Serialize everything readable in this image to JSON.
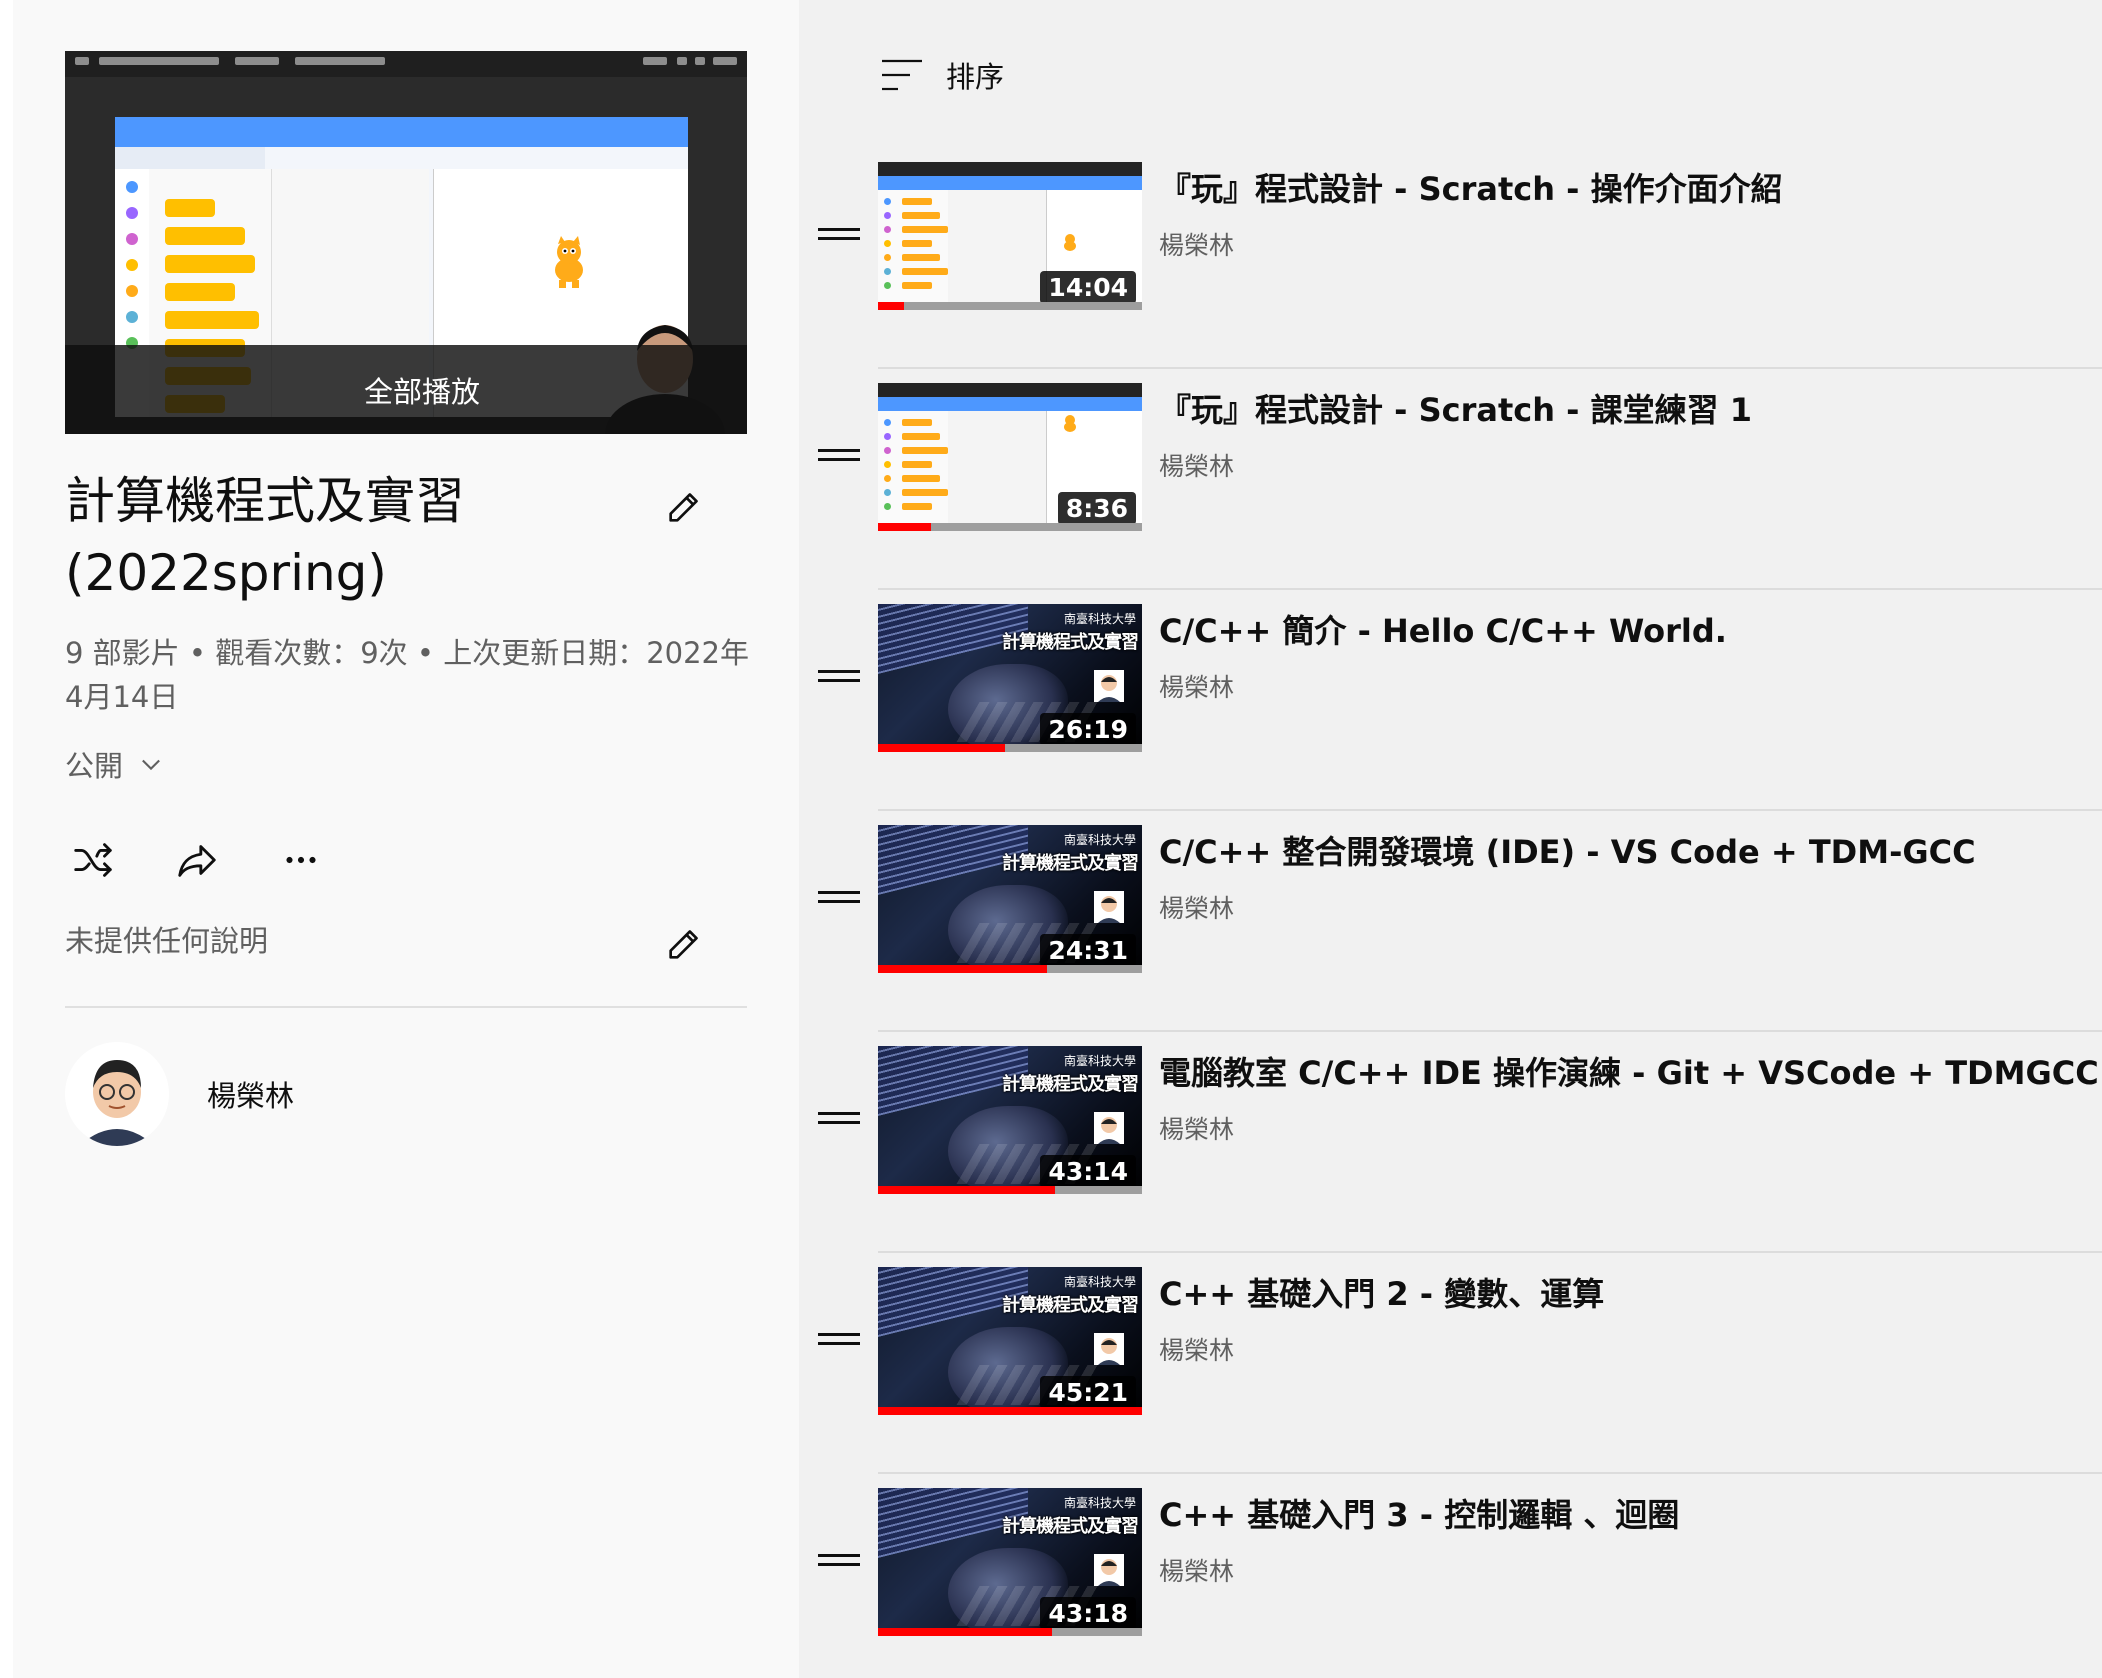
{
  "playlist": {
    "play_all_label": "全部播放",
    "title": "計算機程式及實習 (2022spring)",
    "meta": "9 部影片 • 觀看次數：9次 • 上次更新日期：2022年4月14日",
    "privacy": "公開",
    "description": "未提供任何說明",
    "owner": "楊榮林"
  },
  "sort": {
    "label": "排序"
  },
  "videos": [
    {
      "title": "『玩』程式設計 - Scratch - 操作介面介紹",
      "channel": "楊榮林",
      "duration": "14:04",
      "progress": 0.1,
      "thumb": "scratch"
    },
    {
      "title": "『玩』程式設計 - Scratch - 課堂練習 1",
      "channel": "楊榮林",
      "duration": "8:36",
      "progress": 0.2,
      "thumb": "scratch"
    },
    {
      "title": "C/C++ 簡介 - Hello C/C++ World.",
      "channel": "楊榮林",
      "duration": "26:19",
      "progress": 0.48,
      "thumb": "code"
    },
    {
      "title": "C/C++ 整合開發環境 (IDE) - VS Code + TDM-GCC",
      "channel": "楊榮林",
      "duration": "24:31",
      "progress": 0.64,
      "thumb": "code"
    },
    {
      "title": "電腦教室 C/C++ IDE 操作演練 - Git + VSCode + TDMGCC",
      "channel": "楊榮林",
      "duration": "43:14",
      "progress": 0.67,
      "thumb": "code"
    },
    {
      "title": "C++ 基礎入門 2 - 變數、運算",
      "channel": "楊榮林",
      "duration": "45:21",
      "progress": 1.0,
      "thumb": "code"
    },
    {
      "title": "C++ 基礎入門 3 - 控制邏輯 、迴圈",
      "channel": "楊榮林",
      "duration": "43:18",
      "progress": 0.66,
      "thumb": "code"
    }
  ],
  "thumb_text": {
    "logo": "南臺科技大學",
    "course_title": "計算機程式及實習"
  },
  "colors": {
    "progress_red": "#ff0000",
    "background": "#f1f1f1",
    "secondary_text": "#606060"
  }
}
